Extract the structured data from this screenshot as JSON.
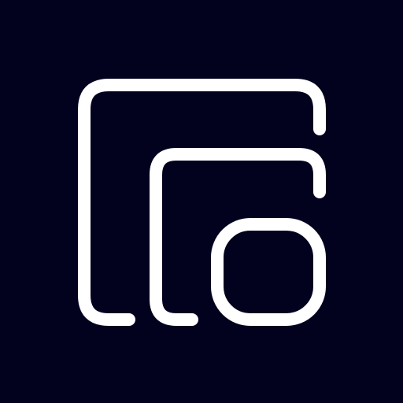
{
  "app_icon": {
    "name": "nested-squares-logo-icon",
    "background_color": "#02021e",
    "stroke_color": "#ffffff"
  }
}
